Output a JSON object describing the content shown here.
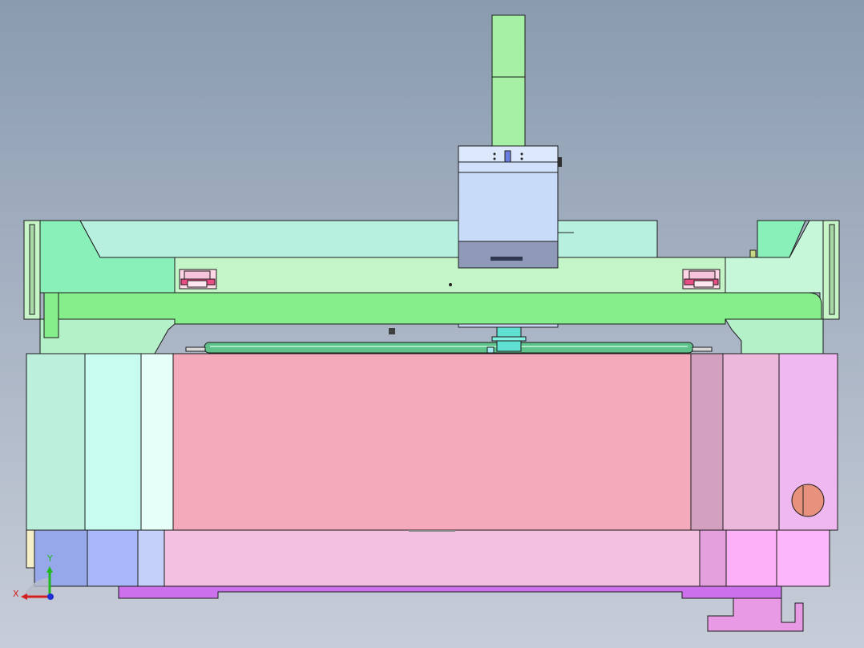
{
  "viewport": {
    "background_top": "#8a9bb0",
    "background_bottom": "#c7cdd8"
  },
  "triad": {
    "x_label": "X",
    "y_label": "Y",
    "x_color": "#d42020",
    "y_color": "#1fb81f",
    "z_color": "#2030d8"
  },
  "colors": {
    "vertical_column": "#a6f0a6",
    "spindle_housing": "#c8dcfa",
    "spindle_base": "#8e9ab8",
    "gantry_upper": "#b8f0e0",
    "gantry_beam": "#c4f5c8",
    "crossbeam": "#86ee8a",
    "side_frame": "#88f0b8",
    "roller": "#5ec28a",
    "tool_head": "#60e0d0",
    "bed_center": "#f5aabb",
    "bed_left_1": "#bcefdc",
    "bed_left_2": "#c8fcf0",
    "bed_left_3": "#e6fff8",
    "bed_right_1": "#d4a0c0",
    "bed_right_2": "#ecb8dc",
    "bed_right_3": "#f0b8f0",
    "base_center": "#f3c0e0",
    "base_left_1": "#96a8ea",
    "base_left_2": "#a8b8fa",
    "base_left_3": "#c4d0fa",
    "base_right_1": "#e4a0dc",
    "base_right_2": "#fcb0f6",
    "base_right_3": "#fcb6fa",
    "rail": "#cc70ec",
    "foot": "#e89ae4",
    "handwheel": "#e8927e",
    "clamp_block": "#f6b4d0"
  }
}
